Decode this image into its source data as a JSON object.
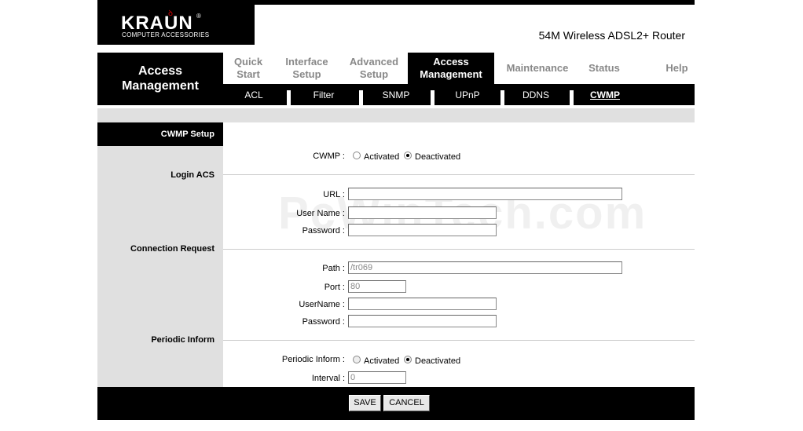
{
  "brand": {
    "logo": "KRAUN",
    "sub": "COMPUTER ACCESSORIES",
    "reg": "®"
  },
  "product_title": "54M Wireless ADSL2+ Router",
  "nav": {
    "section_title_line1": "Access",
    "section_title_line2": "Management",
    "tabs": [
      {
        "line1": "Quick",
        "line2": "Start"
      },
      {
        "line1": "Interface",
        "line2": "Setup"
      },
      {
        "line1": "Advanced",
        "line2": "Setup"
      },
      {
        "line1": "Access",
        "line2": "Management"
      },
      {
        "line1": "Maintenance",
        "line2": ""
      },
      {
        "line1": "Status",
        "line2": ""
      },
      {
        "line1": "Help",
        "line2": ""
      }
    ],
    "active_tab": "Access Management",
    "subtabs": [
      "ACL",
      "Filter",
      "SNMP",
      "UPnP",
      "DDNS",
      "CWMP"
    ],
    "active_subtab": "CWMP"
  },
  "form": {
    "header": "CWMP Setup",
    "cwmp_label": "CWMP :",
    "cwmp_options": [
      "Activated",
      "Deactivated"
    ],
    "cwmp_selected": "Deactivated",
    "login_acs": {
      "label": "Login ACS",
      "url_label": "URL :",
      "url_value": "",
      "username_label": "User Name :",
      "username_value": "",
      "password_label": "Password :",
      "password_value": ""
    },
    "connection_request": {
      "label": "Connection Request",
      "path_label": "Path :",
      "path_value": "/tr069",
      "port_label": "Port :",
      "port_value": "80",
      "username_label": "UserName :",
      "username_value": "",
      "password_label": "Password :",
      "password_value": ""
    },
    "periodic_inform": {
      "label": "Periodic Inform",
      "inform_label": "Periodic Inform :",
      "options": [
        "Activated",
        "Deactivated"
      ],
      "selected": "Deactivated",
      "interval_label": "Interval :",
      "interval_value": "0"
    }
  },
  "buttons": {
    "save": "SAVE",
    "cancel": "CANCEL"
  },
  "watermark": "PcWinTech.com"
}
